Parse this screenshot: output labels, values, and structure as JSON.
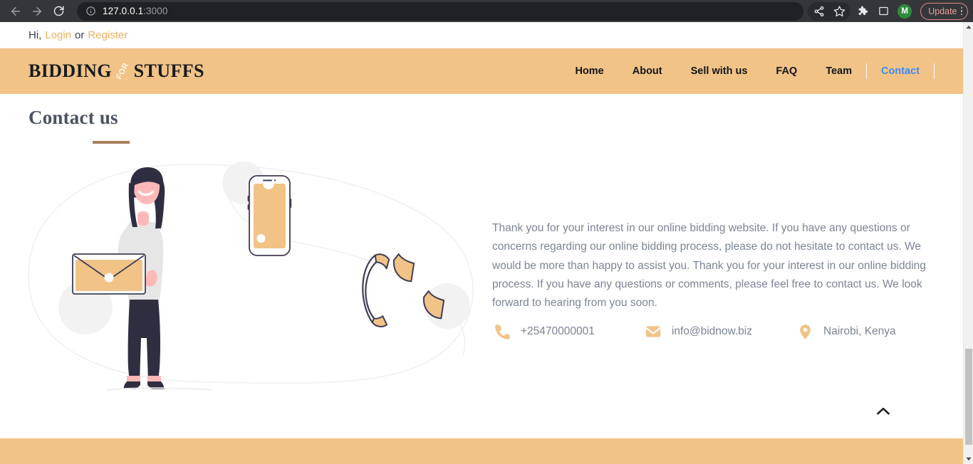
{
  "browser": {
    "back_icon": "arrow-left-icon",
    "forward_icon": "arrow-right-icon",
    "reload_icon": "reload-icon",
    "site_info_icon": "info-circle-icon",
    "url_host": "127.0.0.1",
    "url_port": ":3000",
    "share_icon": "share-icon",
    "bookmark_icon": "star-icon",
    "extensions_icon": "puzzle-piece-icon",
    "sidepanel_icon": "side-panel-icon",
    "profile_initial": "M",
    "update_label": "Update",
    "menu_icon": "kebab-menu-icon"
  },
  "topbar": {
    "greeting": "Hi,",
    "login_label": "Login",
    "conjunction": "or",
    "register_label": "Register"
  },
  "header": {
    "logo_part1": "BIDDING",
    "logo_mid": "FOR",
    "logo_part2": "STUFFS",
    "nav": [
      {
        "label": "Home",
        "active": false
      },
      {
        "label": "About",
        "active": false
      },
      {
        "label": "Sell with us",
        "active": false
      },
      {
        "label": "FAQ",
        "active": false
      },
      {
        "label": "Team",
        "active": false
      },
      {
        "label": "Contact",
        "active": true
      }
    ]
  },
  "main": {
    "title": "Contact us",
    "illustration_name": "contact-illustration-woman-with-envelope",
    "paragraph": "Thank you for your interest in our online bidding website. If you have any questions or concerns regarding our online bidding process, please do not hesitate to contact us. We would be more than happy to assist you. Thank you for your interest in our online bidding process. If you have any questions or comments, please feel free to contact us. We look forward to hearing from you soon.",
    "contacts": [
      {
        "icon": "phone-icon",
        "value": "+25470000001"
      },
      {
        "icon": "envelope-icon",
        "value": "info@bidnow.biz"
      },
      {
        "icon": "location-pin-icon",
        "value": "Nairobi, Kenya"
      }
    ],
    "scroll_top_icon": "chevron-up-icon"
  },
  "colors": {
    "header_band": "#f1c387",
    "accent_orange": "#efb160",
    "active_nav_blue": "#3b8cf6",
    "body_text": "#7b8494",
    "title_text": "#4a5162",
    "rule_brown": "#a5805b",
    "illustration_dark": "#3f3d56",
    "illustration_skin": "#ffb8b8"
  }
}
